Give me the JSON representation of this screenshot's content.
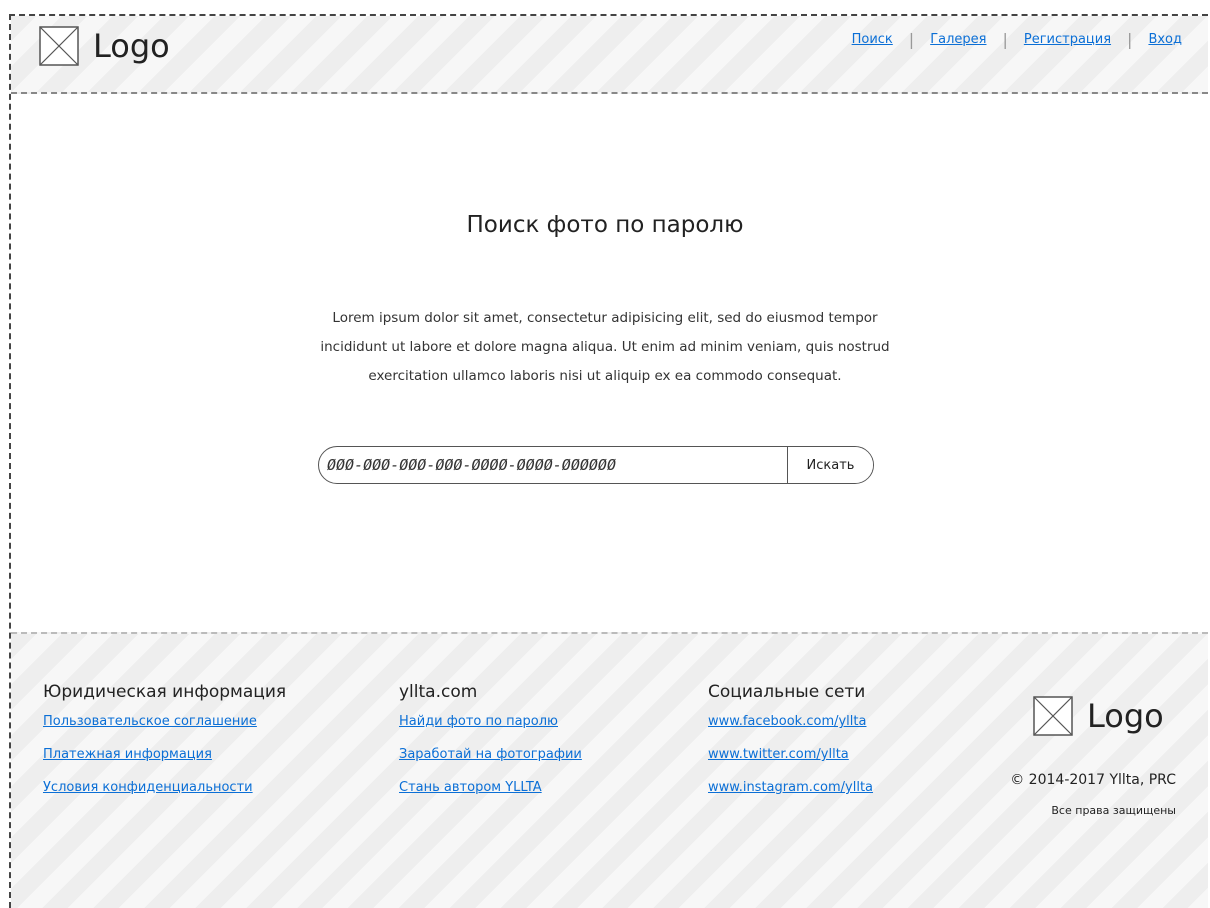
{
  "header": {
    "logo_text": "Logo",
    "nav": [
      "Поиск",
      "Галерея",
      "Регистрация",
      "Вход"
    ]
  },
  "main": {
    "title": "Поиск фото по паролю",
    "description": "Lorem ipsum dolor sit amet, consectetur adipisicing elit, sed do eiusmod tempor incididunt ut labore et dolore magna aliqua. Ut enim ad minim veniam, quis nostrud exercitation ullamco laboris nisi ut aliquip ex ea commodo consequat.",
    "search": {
      "placeholder": "ØØØ-ØØØ-ØØØ-ØØØ-ØØØØ-ØØØØ-ØØØØØØ",
      "button_label": "Искать"
    }
  },
  "footer": {
    "columns": [
      {
        "title": "Юридическая информация",
        "links": [
          "Пользовательское соглашение",
          "Платежная информация",
          "Условия конфиденциальности"
        ]
      },
      {
        "title": "yllta.com",
        "links": [
          "Найди фото по паролю",
          "Заработай на фотографии",
          "Стань автором YLLTA"
        ]
      },
      {
        "title": "Социальные сети",
        "links": [
          "www.facebook.com/yllta",
          "www.twitter.com/yllta",
          "www.instagram.com/yllta"
        ]
      }
    ],
    "logo_text": "Logo",
    "copyright": "© 2014-2017 Yllta, PRC",
    "rights": "Все права защищены"
  },
  "colors": {
    "link": "#0b6fd6",
    "border": "#444444",
    "stripe_bg": "#f7f7f7"
  }
}
